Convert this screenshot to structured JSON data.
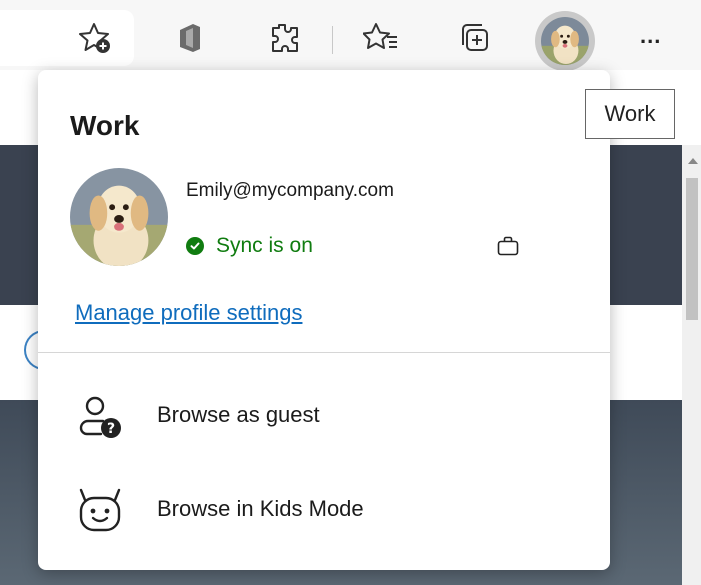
{
  "toolbar": {
    "icons": [
      "add-favorite-icon",
      "office-icon",
      "extensions-icon",
      "favorites-icon",
      "collections-icon",
      "profile-avatar",
      "more-icon"
    ],
    "more_label": "..."
  },
  "tooltip": {
    "text": "Work"
  },
  "profile_flyout": {
    "title": "Work",
    "email": "Emily@mycompany.com",
    "sync_status": "Sync is on",
    "manage_link": "Manage profile settings",
    "menu_items": [
      {
        "label": "Browse as guest",
        "icon": "guest-icon"
      },
      {
        "label": "Browse in Kids Mode",
        "icon": "kids-mode-icon"
      }
    ]
  },
  "colors": {
    "sync_green": "#107c10",
    "link_blue": "#0f6cbd",
    "page_dark": "#3a4250"
  }
}
